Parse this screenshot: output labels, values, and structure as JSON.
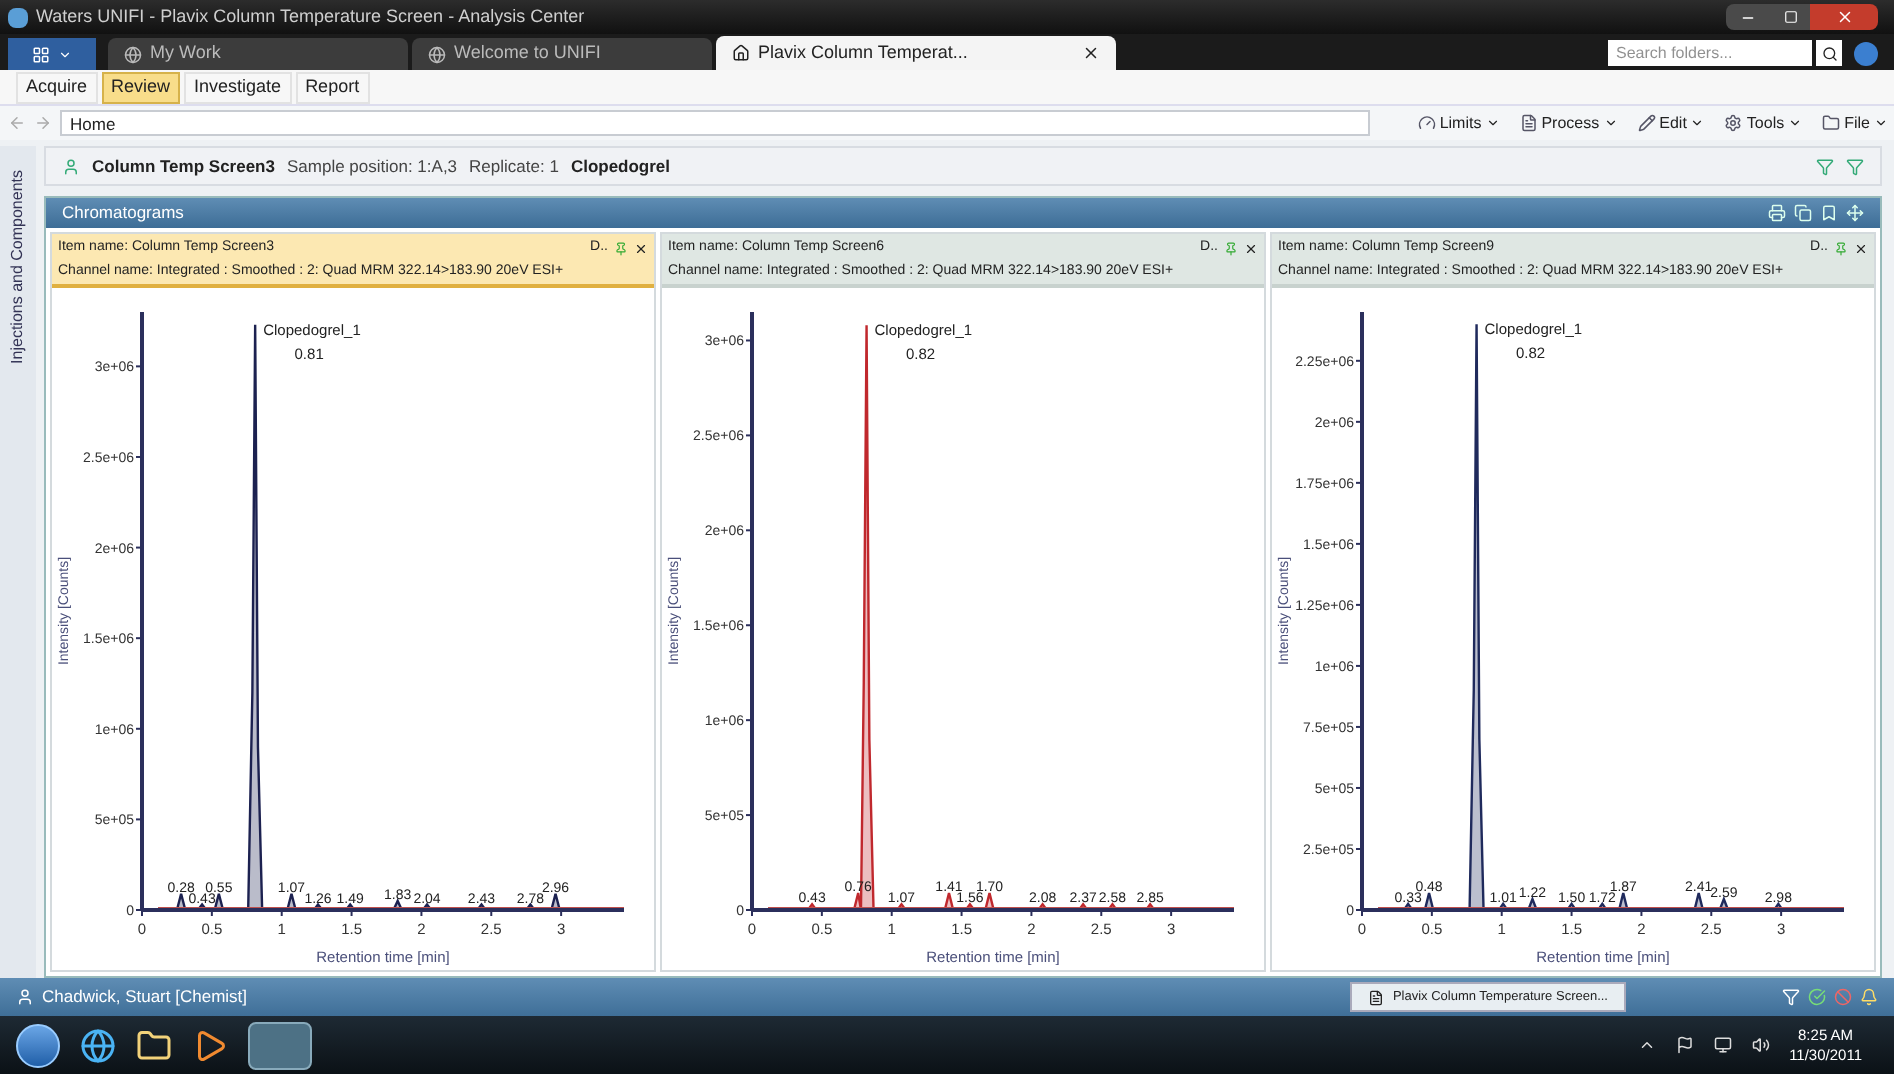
{
  "window": {
    "title": "Waters UNIFI - Plavix Column Temperature Screen - Analysis Center"
  },
  "tabs": [
    {
      "label": "My Work",
      "selected": false
    },
    {
      "label": "Welcome to UNIFI",
      "selected": false
    },
    {
      "label": "Plavix Column Temperat...",
      "selected": true
    }
  ],
  "search": {
    "placeholder": "Search folders..."
  },
  "menu": [
    {
      "label": "Acquire",
      "selected": false
    },
    {
      "label": "Review",
      "selected": true
    },
    {
      "label": "Investigate",
      "selected": false
    },
    {
      "label": "Report",
      "selected": false
    }
  ],
  "address": {
    "value": "Home"
  },
  "toolbar": [
    {
      "label": "Limits",
      "kind": "gauge"
    },
    {
      "label": "Process",
      "kind": "document"
    },
    {
      "label": "Edit",
      "kind": "pencil"
    },
    {
      "label": "Tools",
      "kind": "gear"
    },
    {
      "label": "File",
      "kind": "folder"
    }
  ],
  "context": {
    "item": "Column Temp Screen3",
    "sample_position": "Sample position: 1:A,3",
    "replicate": "Replicate: 1",
    "component": "Clopedogrel"
  },
  "sidebar": {
    "label": "Injections and Components"
  },
  "panel": {
    "title": "Chromatograms",
    "panes": [
      {
        "selected": true,
        "item_name": "Item name: Column Temp Screen3",
        "channel_name": "Channel name: Integrated : Smoothed :  2: Quad MRM 322.14>183.90 20eV ESI+",
        "corner": "D..",
        "chart_data": {
          "type": "area",
          "xlabel": "Retention time [min]",
          "ylabel": "Intensity [Counts]",
          "xlim": [
            0,
            3.45
          ],
          "ylim": [
            0,
            3300000
          ],
          "xticks": [
            0,
            0.5,
            1,
            1.5,
            2,
            2.5,
            3
          ],
          "yticks": [
            {
              "value": 0,
              "label": "0"
            },
            {
              "value": 500000,
              "label": "5e+05"
            },
            {
              "value": 1000000,
              "label": "1e+06"
            },
            {
              "value": 1500000,
              "label": "1.5e+06"
            },
            {
              "value": 2000000,
              "label": "2e+06"
            },
            {
              "value": 2500000,
              "label": "2.5e+06"
            },
            {
              "value": 3000000,
              "label": "3e+06"
            }
          ],
          "x": [
            0,
            0.25,
            0.28,
            0.31,
            0.4,
            0.43,
            0.46,
            0.52,
            0.55,
            0.58,
            0.76,
            0.79,
            0.81,
            0.83,
            0.86,
            1.04,
            1.07,
            1.1,
            1.23,
            1.26,
            1.29,
            1.46,
            1.49,
            1.52,
            1.8,
            1.83,
            1.86,
            2.01,
            2.04,
            2.07,
            2.4,
            2.43,
            2.46,
            2.75,
            2.78,
            2.81,
            2.93,
            2.96,
            2.99,
            3.45
          ],
          "series": [
            {
              "color": "#1c2150",
              "values": [
                0,
                0,
                90000,
                0,
                0,
                30000,
                0,
                0,
                90000,
                0,
                0,
                1200000,
                3230000,
                900000,
                0,
                0,
                90000,
                0,
                0,
                30000,
                0,
                0,
                30000,
                0,
                0,
                50000,
                0,
                0,
                30000,
                0,
                0,
                30000,
                0,
                0,
                30000,
                0,
                0,
                90000,
                0,
                0
              ]
            }
          ],
          "annotations": [
            {
              "x": 0.81,
              "y": 3230000,
              "text": "Clopedogrel_1"
            },
            {
              "x": 0.81,
              "y": 3230000,
              "text": "0.81"
            },
            {
              "x": 0.28,
              "y": 90000,
              "text": "0.28"
            },
            {
              "x": 0.43,
              "y": 30000,
              "text": "0.43"
            },
            {
              "x": 0.55,
              "y": 90000,
              "text": "0.55"
            },
            {
              "x": 1.07,
              "y": 90000,
              "text": "1.07"
            },
            {
              "x": 1.26,
              "y": 30000,
              "text": "1.26"
            },
            {
              "x": 1.49,
              "y": 30000,
              "text": "1.49"
            },
            {
              "x": 1.83,
              "y": 50000,
              "text": "1.83"
            },
            {
              "x": 2.04,
              "y": 30000,
              "text": "2.04"
            },
            {
              "x": 2.43,
              "y": 30000,
              "text": "2.43"
            },
            {
              "x": 2.78,
              "y": 30000,
              "text": "2.78"
            },
            {
              "x": 2.96,
              "y": 90000,
              "text": "2.96"
            }
          ]
        }
      },
      {
        "selected": false,
        "item_name": "Item name: Column Temp Screen6",
        "channel_name": "Channel name: Integrated : Smoothed :  2: Quad MRM 322.14>183.90 20eV ESI+",
        "corner": "D..",
        "chart_data": {
          "type": "area",
          "xlabel": "Retention time [min]",
          "ylabel": "Intensity [Counts]",
          "xlim": [
            0,
            3.45
          ],
          "ylim": [
            0,
            3150000
          ],
          "xticks": [
            0,
            0.5,
            1,
            1.5,
            2,
            2.5,
            3
          ],
          "yticks": [
            {
              "value": 0,
              "label": "0"
            },
            {
              "value": 500000,
              "label": "5e+05"
            },
            {
              "value": 1000000,
              "label": "1e+06"
            },
            {
              "value": 1500000,
              "label": "1.5e+06"
            },
            {
              "value": 2000000,
              "label": "2e+06"
            },
            {
              "value": 2500000,
              "label": "2.5e+06"
            },
            {
              "value": 3000000,
              "label": "3e+06"
            }
          ],
          "x": [
            0,
            0.4,
            0.43,
            0.46,
            0.73,
            0.76,
            0.78,
            0.8,
            0.82,
            0.84,
            0.87,
            1.04,
            1.07,
            1.1,
            1.38,
            1.41,
            1.44,
            1.53,
            1.56,
            1.59,
            1.67,
            1.7,
            1.73,
            2.05,
            2.08,
            2.11,
            2.34,
            2.37,
            2.4,
            2.55,
            2.58,
            2.61,
            2.82,
            2.85,
            2.88,
            3.45
          ],
          "series": [
            {
              "color": "#c0282d",
              "values": [
                0,
                0,
                30000,
                0,
                0,
                90000,
                0,
                1200000,
                3080000,
                900000,
                0,
                0,
                30000,
                0,
                0,
                90000,
                0,
                0,
                30000,
                0,
                0,
                90000,
                0,
                0,
                30000,
                0,
                0,
                30000,
                0,
                0,
                30000,
                0,
                0,
                30000,
                0,
                0
              ]
            }
          ],
          "annotations": [
            {
              "x": 0.82,
              "y": 3080000,
              "text": "Clopedogrel_1"
            },
            {
              "x": 0.82,
              "y": 3080000,
              "text": "0.82"
            },
            {
              "x": 0.43,
              "y": 30000,
              "text": "0.43"
            },
            {
              "x": 0.76,
              "y": 90000,
              "text": "0.76"
            },
            {
              "x": 1.07,
              "y": 30000,
              "text": "1.07"
            },
            {
              "x": 1.41,
              "y": 90000,
              "text": "1.41"
            },
            {
              "x": 1.56,
              "y": 30000,
              "text": "1.56"
            },
            {
              "x": 1.7,
              "y": 90000,
              "text": "1.70"
            },
            {
              "x": 2.08,
              "y": 30000,
              "text": "2.08"
            },
            {
              "x": 2.37,
              "y": 30000,
              "text": "2.37"
            },
            {
              "x": 2.58,
              "y": 30000,
              "text": "2.58"
            },
            {
              "x": 2.85,
              "y": 30000,
              "text": "2.85"
            }
          ]
        }
      },
      {
        "selected": false,
        "item_name": "Item name: Column Temp Screen9",
        "channel_name": "Channel name: Integrated : Smoothed :  2: Quad MRM 322.14>183.90 20eV ESI+",
        "corner": "D..",
        "chart_data": {
          "type": "area",
          "xlabel": "Retention time [min]",
          "ylabel": "Intensity [Counts]",
          "xlim": [
            0,
            3.45
          ],
          "ylim": [
            0,
            2450000
          ],
          "xticks": [
            0,
            0.5,
            1,
            1.5,
            2,
            2.5,
            3
          ],
          "yticks": [
            {
              "value": 0,
              "label": "0"
            },
            {
              "value": 250000,
              "label": "2.5e+05"
            },
            {
              "value": 500000,
              "label": "5e+05"
            },
            {
              "value": 750000,
              "label": "7.5e+05"
            },
            {
              "value": 1000000,
              "label": "1e+06"
            },
            {
              "value": 1250000,
              "label": "1.25e+06"
            },
            {
              "value": 1500000,
              "label": "1.5e+06"
            },
            {
              "value": 1750000,
              "label": "1.75e+06"
            },
            {
              "value": 2000000,
              "label": "2e+06"
            },
            {
              "value": 2250000,
              "label": "2.25e+06"
            }
          ],
          "x": [
            0,
            0.3,
            0.33,
            0.36,
            0.45,
            0.48,
            0.51,
            0.77,
            0.8,
            0.82,
            0.84,
            0.87,
            0.98,
            1.01,
            1.04,
            1.19,
            1.22,
            1.25,
            1.47,
            1.5,
            1.53,
            1.69,
            1.72,
            1.75,
            1.84,
            1.87,
            1.9,
            2.38,
            2.41,
            2.44,
            2.56,
            2.59,
            2.62,
            2.95,
            2.98,
            3.01,
            3.45
          ],
          "series": [
            {
              "color": "#1f2a5c",
              "values": [
                0,
                0,
                25000,
                0,
                0,
                70000,
                0,
                0,
                900000,
                2400000,
                700000,
                0,
                0,
                25000,
                0,
                0,
                45000,
                0,
                0,
                25000,
                0,
                0,
                25000,
                0,
                0,
                70000,
                0,
                0,
                70000,
                0,
                0,
                45000,
                0,
                0,
                25000,
                0,
                0
              ]
            }
          ],
          "annotations": [
            {
              "x": 0.82,
              "y": 2400000,
              "text": "Clopedogrel_1"
            },
            {
              "x": 0.82,
              "y": 2400000,
              "text": "0.82"
            },
            {
              "x": 0.33,
              "y": 25000,
              "text": "0.33"
            },
            {
              "x": 0.48,
              "y": 70000,
              "text": "0.48"
            },
            {
              "x": 1.01,
              "y": 25000,
              "text": "1.01"
            },
            {
              "x": 1.22,
              "y": 45000,
              "text": "1.22"
            },
            {
              "x": 1.5,
              "y": 25000,
              "text": "1.50"
            },
            {
              "x": 1.72,
              "y": 25000,
              "text": "1.72"
            },
            {
              "x": 1.87,
              "y": 70000,
              "text": "1.87"
            },
            {
              "x": 2.41,
              "y": 70000,
              "text": "2.41"
            },
            {
              "x": 2.59,
              "y": 45000,
              "text": "2.59"
            },
            {
              "x": 2.98,
              "y": 25000,
              "text": "2.98"
            }
          ]
        }
      }
    ]
  },
  "status_bar": {
    "user": "Chadwick, Stuart [Chemist]",
    "task": "Plavix Column Temperature Screen..."
  },
  "taskbar": {
    "time": "8:25 AM",
    "date": "11/30/2011"
  }
}
